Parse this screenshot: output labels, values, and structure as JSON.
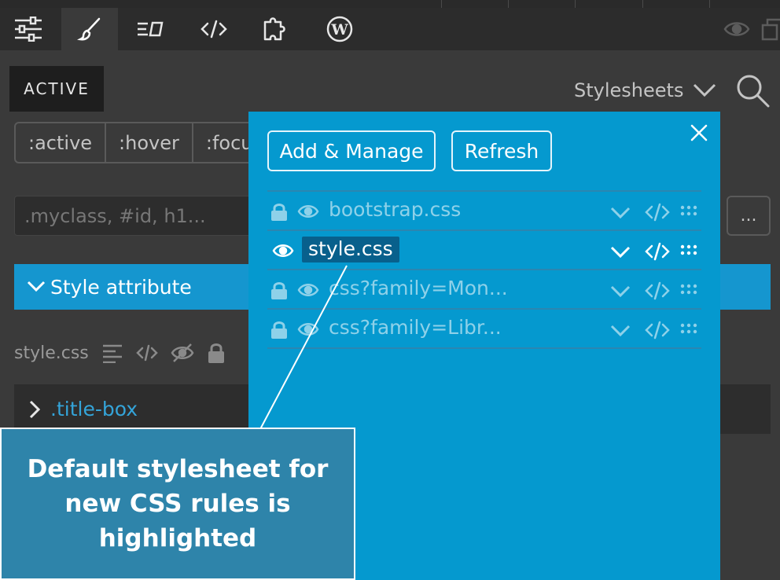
{
  "toolbar": {
    "tools": [
      {
        "icon": "settings-sliders-icon"
      },
      {
        "icon": "brush-icon",
        "active": true
      },
      {
        "icon": "text-box-icon"
      },
      {
        "icon": "code-icon"
      },
      {
        "icon": "puzzle-icon"
      },
      {
        "icon": "wordpress-icon"
      }
    ],
    "right_icons": [
      "eye-icon",
      "window-icon"
    ]
  },
  "tabs": {
    "active_label": "ACTIVE",
    "stylesheets_label": "Stylesheets"
  },
  "pseudo_states": [
    ":active",
    ":hover",
    ":focu"
  ],
  "selector": {
    "placeholder": ".myclass, #id, h1..."
  },
  "more_button": "...",
  "style_attribute": {
    "label": "Style attribute"
  },
  "current_sheet": {
    "name": "style.css"
  },
  "rule": {
    "selector": ".title-box"
  },
  "popover": {
    "add_manage": "Add & Manage",
    "refresh": "Refresh",
    "sheets": [
      {
        "name": "bootstrap.css",
        "locked": true,
        "default": false
      },
      {
        "name": "style.css",
        "locked": false,
        "default": true
      },
      {
        "name": "css?family=Mon...",
        "locked": true,
        "default": false
      },
      {
        "name": "css?family=Libr...",
        "locked": true,
        "default": false
      }
    ]
  },
  "callout": {
    "text": "Default stylesheet for new CSS rules is highlighted"
  },
  "colors": {
    "accent": "#1596cf",
    "popover_bg": "#0599cf",
    "callout_bg": "#2e84aa",
    "default_highlight": "#08608c",
    "panel_bg": "#3a3a3a"
  }
}
